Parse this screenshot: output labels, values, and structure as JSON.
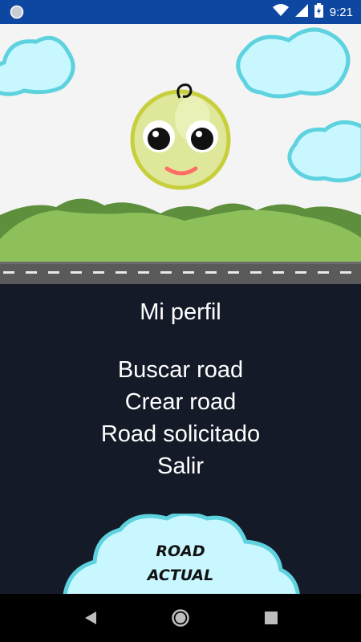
{
  "status_bar": {
    "time": "9:21",
    "icons": [
      "notification-dot-icon",
      "wifi-icon",
      "signal-icon",
      "battery-icon"
    ]
  },
  "menu": {
    "profile": "Mi perfil",
    "search_road": "Buscar road",
    "create_road": "Crear road",
    "requested_road": "Road solicitado",
    "exit": "Salir"
  },
  "current_road": {
    "line1": "ROAD",
    "line2": "ACTUAL"
  },
  "navbar": {
    "icons": [
      "back-icon",
      "home-icon",
      "recents-icon"
    ]
  },
  "colors": {
    "status_bar": "#0d47a1",
    "menu_background": "#141a28",
    "cloud_fill": "#c9f7ff",
    "cloud_stroke": "#5ed3df",
    "hills": "#8dc05a",
    "road": "#5a5a5a",
    "character": "#dfe79a"
  }
}
